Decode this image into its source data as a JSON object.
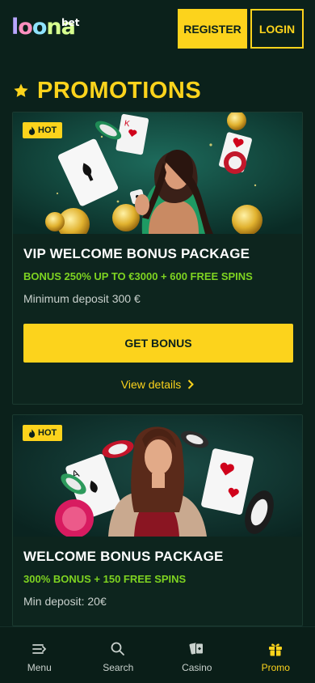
{
  "brand": {
    "logo_parts": [
      "l",
      "o",
      "o",
      "na"
    ],
    "logo_superscript": "bet",
    "accent_color": "#fcd31c",
    "bonus_color": "#7ed321",
    "background_color": "#0b211b"
  },
  "header": {
    "register_label": "REGISTER",
    "login_label": "LOGIN"
  },
  "section": {
    "title": "PROMOTIONS",
    "icon": "star-icon"
  },
  "promotions": [
    {
      "badge": "HOT",
      "badge_icon": "fire-icon",
      "title": "VIP WELCOME BONUS PACKAGE",
      "bonus": "BONUS 250% UP TO €3000 + 600 FREE SPINS",
      "deposit": "Minimum deposit 300 €",
      "cta": "GET BONUS",
      "details": "View details"
    },
    {
      "badge": "HOT",
      "badge_icon": "fire-icon",
      "title": "WELCOME BONUS PACKAGE",
      "bonus": "300% BONUS + 150 FREE SPINS",
      "deposit": "Min deposit: 20€"
    }
  ],
  "bottom_nav": [
    {
      "label": "Menu",
      "icon": "menu-icon",
      "active": false
    },
    {
      "label": "Search",
      "icon": "search-icon",
      "active": false
    },
    {
      "label": "Casino",
      "icon": "cards-icon",
      "active": false
    },
    {
      "label": "Promo",
      "icon": "gift-icon",
      "active": true
    }
  ]
}
